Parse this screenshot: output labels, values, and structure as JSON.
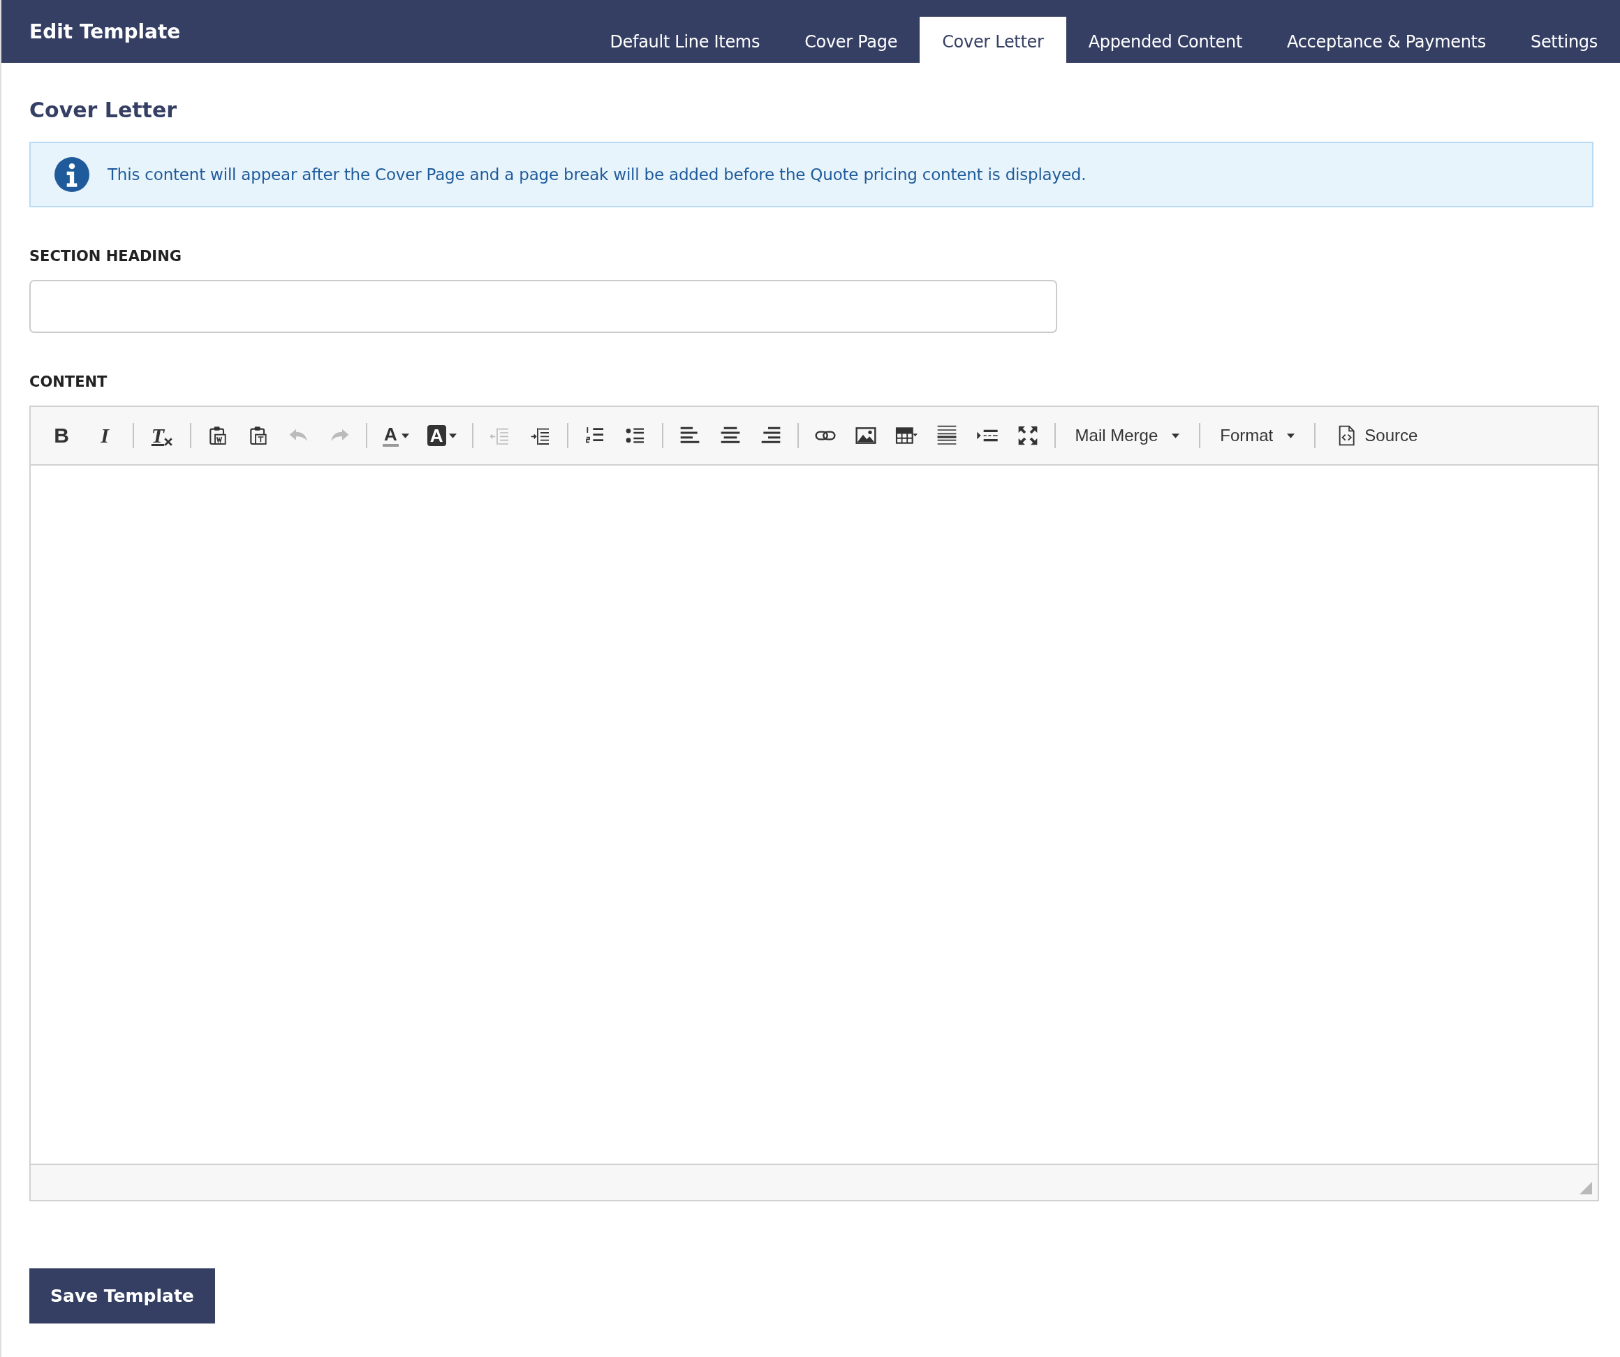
{
  "header": {
    "title": "Edit Template",
    "tabs": [
      {
        "label": "Default Line Items",
        "selected": false
      },
      {
        "label": "Cover Page",
        "selected": false
      },
      {
        "label": "Cover Letter",
        "selected": true
      },
      {
        "label": "Appended Content",
        "selected": false
      },
      {
        "label": "Acceptance & Payments",
        "selected": false
      },
      {
        "label": "Settings",
        "selected": false
      }
    ]
  },
  "section_title": "Cover Letter",
  "info_message": "This content will appear after the Cover Page and a page break will be added before the Quote pricing content is displayed.",
  "section_heading": {
    "label": "SECTION HEADING"
  },
  "content": {
    "label": "CONTENT",
    "toolbar": [
      [
        {
          "kind": "bold",
          "glyph": "B",
          "disabled": false
        },
        {
          "kind": "italic",
          "glyph": "I",
          "disabled": false
        }
      ],
      [
        {
          "kind": "removeformat",
          "glyph": "T",
          "disabled": false
        }
      ],
      [
        {
          "kind": "pasteword",
          "disabled": false
        },
        {
          "kind": "pastetext",
          "disabled": false
        },
        {
          "kind": "undo",
          "disabled": true
        },
        {
          "kind": "redo",
          "disabled": true
        }
      ],
      [
        {
          "kind": "textcolor",
          "glyph": "A",
          "disabled": false
        },
        {
          "kind": "bgcolor",
          "glyph": "A",
          "disabled": false
        }
      ],
      [
        {
          "kind": "outdent",
          "disabled": true
        },
        {
          "kind": "indent",
          "disabled": false
        }
      ],
      [
        {
          "kind": "numbered",
          "disabled": false
        },
        {
          "kind": "bulleted",
          "disabled": false
        }
      ],
      [
        {
          "kind": "alignleft",
          "disabled": false
        },
        {
          "kind": "aligncenter",
          "disabled": false
        },
        {
          "kind": "alignright",
          "disabled": false
        }
      ],
      [
        {
          "kind": "link",
          "disabled": false
        },
        {
          "kind": "image",
          "disabled": false
        },
        {
          "kind": "table",
          "disabled": false
        },
        {
          "kind": "rule",
          "disabled": false
        },
        {
          "kind": "pagebreak",
          "disabled": false
        },
        {
          "kind": "maximize",
          "disabled": false
        }
      ],
      [
        {
          "kind": "dropdown",
          "label": "Mail Merge",
          "disabled": false
        }
      ],
      [
        {
          "kind": "dropdown",
          "label": "Format",
          "disabled": false
        }
      ],
      [
        {
          "kind": "source",
          "label": "Source",
          "disabled": false
        }
      ]
    ]
  },
  "save_button": "Save Template"
}
